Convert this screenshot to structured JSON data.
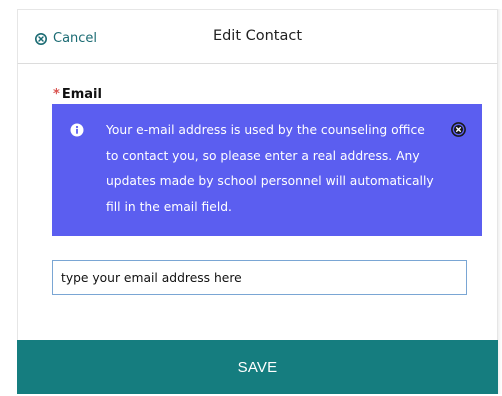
{
  "header": {
    "cancel_label": "Cancel",
    "title": "Edit Contact",
    "cancel_icon": "circle-x-icon"
  },
  "form": {
    "required_marker": "*",
    "email_label": "Email",
    "info": {
      "icon": "info-icon",
      "close_icon": "circle-x-icon",
      "text": "Your e-mail address is used by the counseling office to contact you, so please enter a real address. Any updates made by school personnel will automatically fill in the email field."
    },
    "email_input": {
      "value": "type your email address here",
      "placeholder": ""
    }
  },
  "footer": {
    "save_label": "SAVE"
  },
  "colors": {
    "accent": "#157d7f",
    "cancel_text": "#1b6b73",
    "info_background": "#5b5ef0",
    "required": "#d9534f",
    "input_border": "#7aa6d4"
  }
}
